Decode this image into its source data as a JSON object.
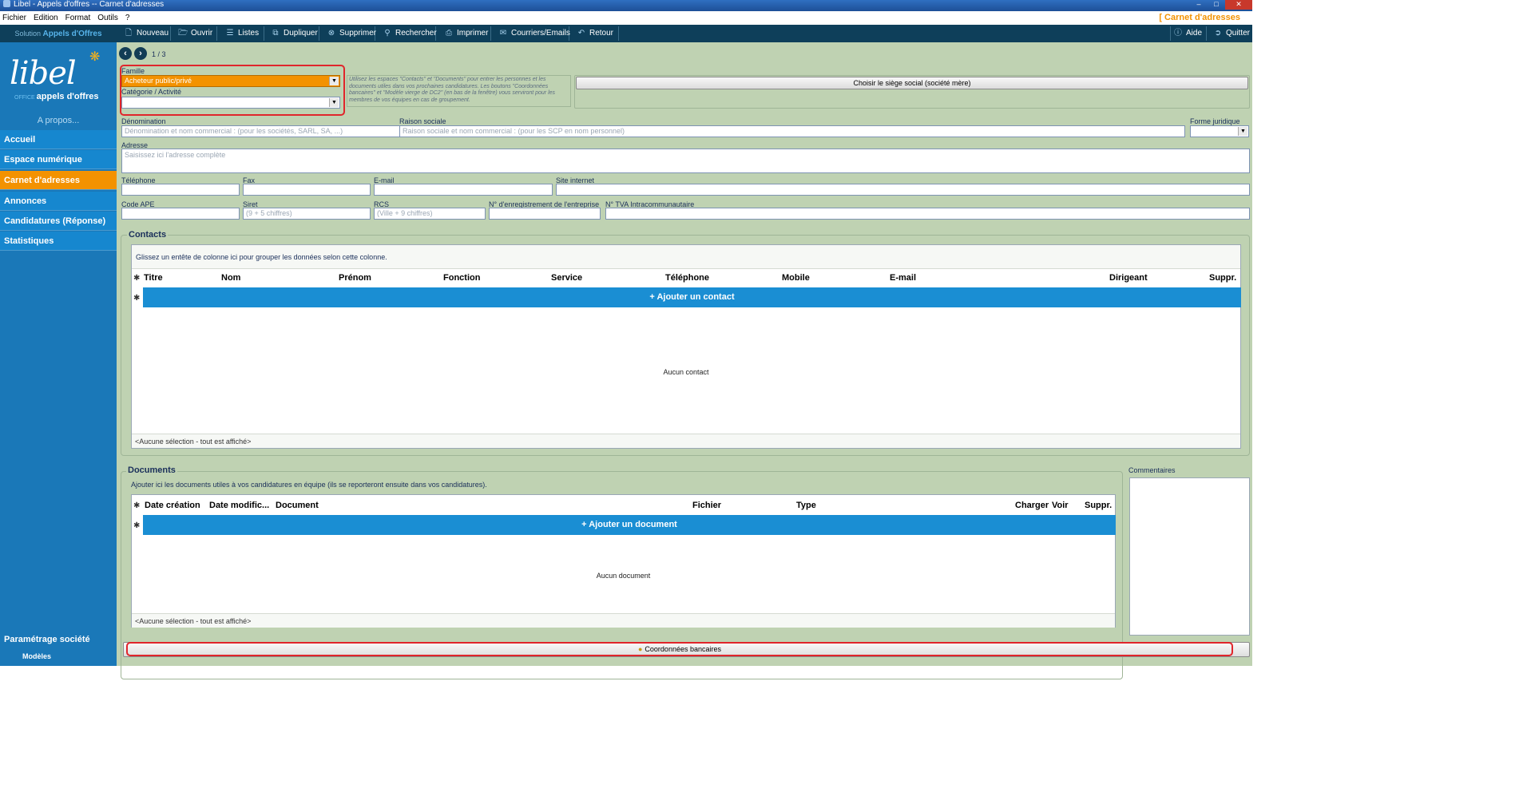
{
  "window": {
    "title": "Libel - Appels d'offres -- Carnet d'adresses"
  },
  "menu": {
    "items": [
      "Fichier",
      "Edition",
      "Format",
      "Outils",
      "?"
    ],
    "module_label": "[ Carnet d'adresses"
  },
  "toolbar": {
    "solution_prefix": "Solution",
    "solution_name": "Appels d'Offres",
    "buttons": [
      "Nouveau",
      "Ouvrir",
      "Listes",
      "Dupliquer",
      "Supprimer",
      "Rechercher",
      "Imprimer",
      "Courriers/Emails",
      "Retour"
    ],
    "help_label": "Aide",
    "quit_label": "Quitter"
  },
  "logo": {
    "brand": "libel",
    "sub_prefix": "OFFICE",
    "sub_name": "appels d'offres"
  },
  "sidebar": {
    "apropos": "A propos...",
    "items": [
      "Accueil",
      "Espace numérique",
      "Carnet d'adresses",
      "Annonces",
      "Candidatures (Réponse)",
      "Statistiques"
    ],
    "active": "Carnet d'adresses",
    "bottom_item": "Paramétrage société",
    "sub_item": "Modèles"
  },
  "nav": {
    "record_position": "1 / 3"
  },
  "form": {
    "famille_label": "Famille",
    "famille_value": "Acheteur public/privé",
    "categorie_label": "Catégorie / Activité",
    "categorie_value": "",
    "hint_text": "Utilisez les espaces \"Contacts\" et \"Documents\" pour entrer les personnes et les documents utiles dans vos prochaines candidatures. Les boutons \"Coordonnées bancaires\" et \"Modèle vierge de DC2\" (en bas de la fenêtre) vous serviront pour les membres de vos équipes en cas de groupement.",
    "siege_button": "Choisir le siège social (société mère)",
    "denomination_label": "Dénomination",
    "denomination_placeholder": "Dénomination et nom commercial : (pour les sociétés, SARL, SA, ...)",
    "raison_label": "Raison sociale",
    "raison_placeholder": "Raison sociale et nom commercial : (pour les SCP en nom personnel)",
    "forme_label": "Forme juridique",
    "adresse_label": "Adresse",
    "adresse_placeholder": "Saisissez ici l'adresse complète",
    "telephone_label": "Téléphone",
    "fax_label": "Fax",
    "email_label": "E-mail",
    "site_label": "Site internet",
    "ape_label": "Code APE",
    "siret_label": "Siret",
    "siret_placeholder": "(9 + 5 chiffres)",
    "rcs_label": "RCS",
    "rcs_placeholder": "(Ville + 9 chiffres)",
    "enregistrement_label": "N° d'enregistrement de l'entreprise",
    "tva_label": "N° TVA Intracommunautaire"
  },
  "contacts": {
    "title": "Contacts",
    "group_hint": "Glissez un entête de colonne ici pour grouper les données selon cette colonne.",
    "columns": [
      "Titre",
      "Nom",
      "Prénom",
      "Fonction",
      "Service",
      "Téléphone",
      "Mobile",
      "E-mail",
      "Dirigeant",
      "Suppr."
    ],
    "add_label": "+ Ajouter un contact",
    "empty_text": "Aucun contact",
    "footer": "<Aucune sélection - tout est affiché>"
  },
  "documents": {
    "title": "Documents",
    "hint": "Ajouter ici les documents utiles à vos candidatures en équipe (ils se reporteront ensuite dans vos candidatures).",
    "columns": [
      "Date création",
      "Date modific...",
      "Document",
      "Fichier",
      "Type",
      "Charger",
      "Voir",
      "Suppr."
    ],
    "add_label": "+ Ajouter un document",
    "empty_text": "Aucun document",
    "footer": "<Aucune sélection - tout est affiché>"
  },
  "comments": {
    "label": "Commentaires"
  },
  "bank_button": "Coordonnées bancaires",
  "colors": {
    "accent_orange": "#f39200",
    "nav_blue": "#1687cf",
    "toolbar_dark": "#0e3f5a",
    "panel_green": "#bfd2b2",
    "highlight_red": "#e0252b"
  }
}
